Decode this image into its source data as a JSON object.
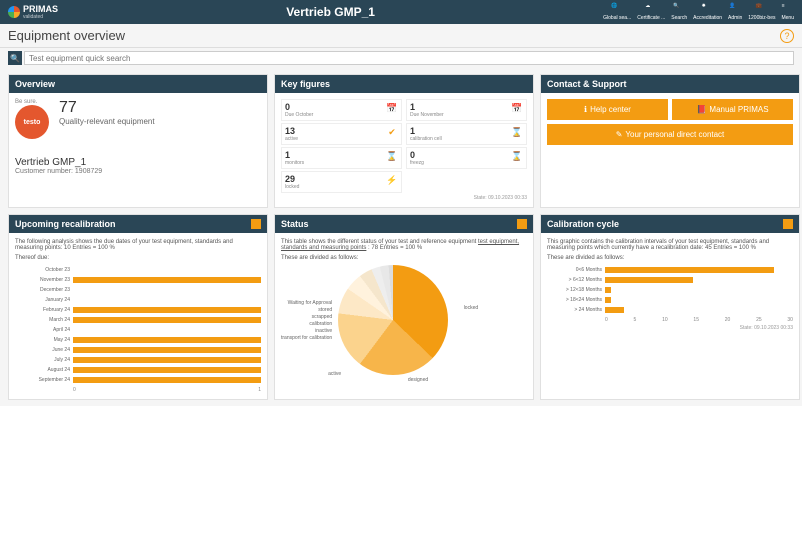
{
  "header": {
    "brand": "PRIMAS",
    "brand_sub": "validated",
    "title": "Vertrieb GMP_1",
    "tools": [
      {
        "name": "globe-icon",
        "label": "Global sea..."
      },
      {
        "name": "cloud-icon",
        "label": "Certificate ..."
      },
      {
        "name": "search-icon",
        "label": "Search"
      },
      {
        "name": "gear-icon",
        "label": "Accreditation"
      },
      {
        "name": "user-icon",
        "label": "Admin"
      },
      {
        "name": "briefcase-icon",
        "label": "1200biz-bes"
      },
      {
        "name": "menu-icon",
        "label": "Menu"
      }
    ]
  },
  "page_title": "Equipment overview",
  "search": {
    "placeholder": "Test equipment quick search"
  },
  "overview": {
    "heading": "Overview",
    "besure": "Be sure.",
    "brandball": "testo",
    "count": "77",
    "count_label": "Quality-relevant equipment",
    "vendor": "Vertrieb GMP_1",
    "customer_label": "Customer number: 1908729"
  },
  "keyfigures": {
    "heading": "Key figures",
    "left": [
      {
        "n": "0",
        "l": "Due October",
        "icon": "📅",
        "color": "#f39c12"
      },
      {
        "n": "13",
        "l": "active",
        "icon": "✔",
        "color": "#f39c12"
      },
      {
        "n": "1",
        "l": "monitors",
        "icon": "⌛",
        "color": "#f39c12"
      },
      {
        "n": "29",
        "l": "locked",
        "icon": "⚡",
        "color": "#bbb"
      }
    ],
    "right": [
      {
        "n": "1",
        "l": "Due November",
        "icon": "📅",
        "color": "#f39c12"
      },
      {
        "n": "1",
        "l": "calibration cell",
        "icon": "⌛",
        "color": "#f39c12"
      },
      {
        "n": "0",
        "l": "freezg",
        "icon": "⌛",
        "color": "#f39c12"
      }
    ],
    "state": "State: 09.10.2023 00:33"
  },
  "contact": {
    "heading": "Contact & Support",
    "buttons": [
      {
        "label": "Help center",
        "icon": "ℹ"
      },
      {
        "label": "Manual PRIMAS",
        "icon": "📕"
      },
      {
        "label": "Your personal direct contact",
        "icon": "✎",
        "full": true
      }
    ]
  },
  "recal": {
    "heading": "Upcoming recalibration",
    "intro": "The following analysis shows the due dates of your test equipment, standards and measuring points: 10 Entries = 100 %",
    "sub": "Thereof due:",
    "axis": [
      "0",
      "1"
    ]
  },
  "status": {
    "heading": "Status",
    "intro_prefix": "This table shows the different status of your test and reference equipment ",
    "intro_link": "test equipment, standards and measuring points",
    "intro_suffix": " : 78 Entries = 100 %",
    "sub": "These are divided as follows:",
    "legend_left": [
      "Waiting for Approval",
      "stored",
      "scrapped",
      "calibration",
      "inactive",
      "transport for calibration"
    ],
    "label_locked": "locked",
    "label_active": "active",
    "label_designed": "designed"
  },
  "cycle": {
    "heading": "Calibration cycle",
    "intro": "This graphic contains the calibration intervals of your test equipment, standards and measuring points which currently have a recalibration date: 45 Entries = 100 %",
    "sub": "These are divided as follows:",
    "axis": [
      "0",
      "5",
      "10",
      "15",
      "20",
      "25",
      "30"
    ],
    "state": "State: 09.10.2023 00:33"
  },
  "chart_data": [
    {
      "type": "bar",
      "title": "Upcoming recalibration",
      "xlabel": "",
      "ylabel": "",
      "xlim": [
        0,
        1
      ],
      "categories": [
        "October 23",
        "November 23",
        "December 23",
        "January 24",
        "February 24",
        "March 24",
        "April 24",
        "May 24",
        "June 24",
        "July 24",
        "August 24",
        "September 24"
      ],
      "values": [
        0,
        1,
        0,
        0,
        1,
        1,
        0,
        1,
        1,
        1,
        1,
        1
      ]
    },
    {
      "type": "pie",
      "title": "Status",
      "series": [
        {
          "name": "locked",
          "value": 29,
          "color": "#f39c12"
        },
        {
          "name": "designed",
          "value": 18,
          "color": "#f7b54a"
        },
        {
          "name": "active",
          "value": 13,
          "color": "#fbd38d"
        },
        {
          "name": "transport for calibration",
          "value": 6,
          "color": "#fde8c6"
        },
        {
          "name": "inactive",
          "value": 4,
          "color": "#fff2dd"
        },
        {
          "name": "calibration",
          "value": 3,
          "color": "#f5e6cc"
        },
        {
          "name": "scrapped",
          "value": 2,
          "color": "#eee"
        },
        {
          "name": "stored",
          "value": 2,
          "color": "#e8e8e8"
        },
        {
          "name": "Waiting for Approval",
          "value": 1,
          "color": "#ddd"
        }
      ],
      "total": 78
    },
    {
      "type": "bar",
      "title": "Calibration cycle",
      "xlabel": "",
      "ylabel": "",
      "xlim": [
        0,
        30
      ],
      "categories": [
        "0<6 Months",
        "> 6<12 Months",
        "> 12<18 Months",
        "> 18<24 Months",
        "> 24 Months"
      ],
      "values": [
        27,
        14,
        1,
        1,
        3
      ]
    }
  ]
}
